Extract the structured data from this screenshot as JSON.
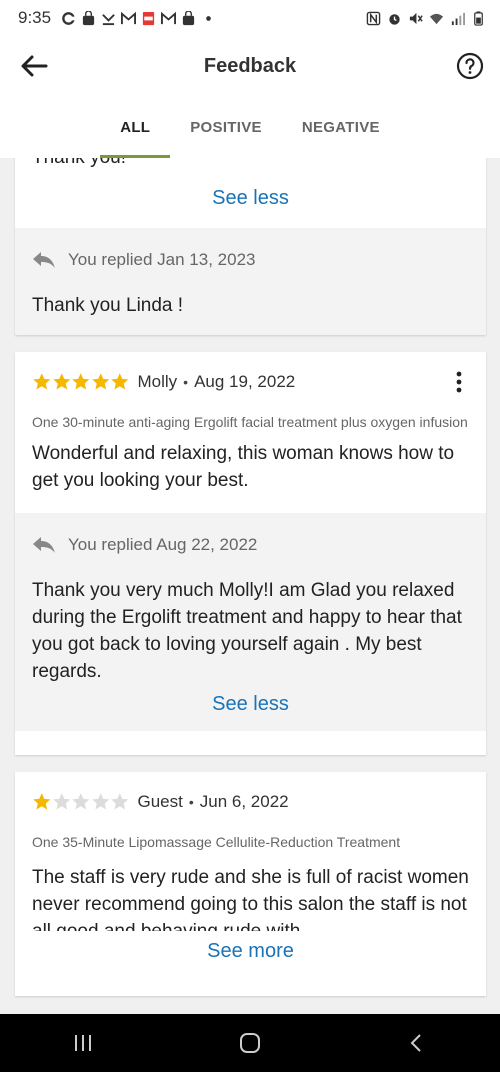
{
  "status_bar": {
    "time": "9:35"
  },
  "app_bar": {
    "title": "Feedback"
  },
  "tabs": [
    {
      "label": "ALL",
      "active": true
    },
    {
      "label": "POSITIVE",
      "active": false
    },
    {
      "label": "NEGATIVE",
      "active": false
    }
  ],
  "cards": [
    {
      "partial_text": "Thank you!",
      "see_label": "See less",
      "reply": {
        "label": "You replied Jan 13, 2023",
        "text": "Thank you Linda !"
      }
    },
    {
      "rating": 5,
      "reviewer": "Molly",
      "date": "Aug 19, 2022",
      "service": "One 30-minute anti-aging Ergolift facial treatment plus oxygen infusion",
      "text": "Wonderful and relaxing, this woman knows how to get you looking your best.",
      "reply": {
        "label": "You replied Aug 22, 2022",
        "text": "Thank you very much Molly!I am  Glad you relaxed during the Ergolift  treatment and happy to hear that you got back to loving yourself again . My best regards."
      },
      "see_label": "See less"
    },
    {
      "rating": 1,
      "reviewer": "Guest",
      "date": "Jun 6, 2022",
      "service": "One 35-Minute Lipomassage Cellulite-Reduction Treatment",
      "text": "The staff is very rude and she is full of racist women never recommend going to this salon the staff is not all good and behaving rude with",
      "see_label": "See more"
    }
  ],
  "colors": {
    "accent": "#7a9a3a",
    "link": "#1a73b8",
    "star_filled": "#f5b800",
    "star_empty": "#dcdcdc"
  }
}
